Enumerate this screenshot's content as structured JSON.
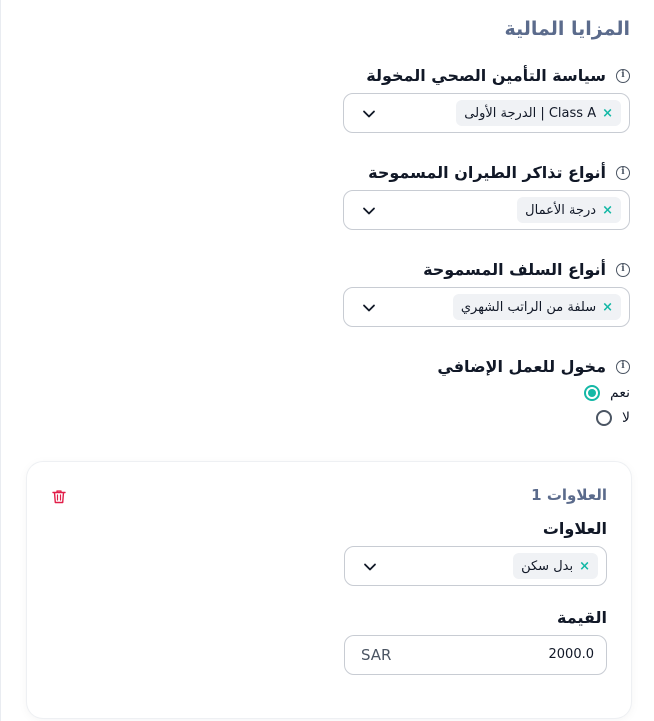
{
  "section": {
    "title": "المزايا المالية"
  },
  "insurance": {
    "label": "سياسة التأمين الصحي المخولة",
    "chip": "Class A | الدرجة الأولى"
  },
  "flights": {
    "label": "أنواع تذاكر الطيران المسموحة",
    "chip": "درجة الأعمال"
  },
  "advances": {
    "label": "أنواع السلف المسموحة",
    "chip": "سلفة من الراتب الشهري"
  },
  "overtime": {
    "label": "مخول للعمل الإضافي",
    "options": [
      {
        "label": "نعم",
        "selected": true
      },
      {
        "label": "لا",
        "selected": false
      }
    ]
  },
  "allowance_card": {
    "title": "العلاوات 1",
    "allowances_label": "العلاوات",
    "allowances_chip": "بدل سكن",
    "value_label": "القيمة",
    "value": "2000.0",
    "currency": "SAR"
  },
  "icons": {
    "info": "info-icon",
    "chevron": "chevron-down-icon",
    "remove": "close-icon",
    "delete": "trash-icon"
  },
  "colors": {
    "accent": "#14b8a6",
    "title": "#5b6b8c",
    "delete": "#e11d48"
  }
}
